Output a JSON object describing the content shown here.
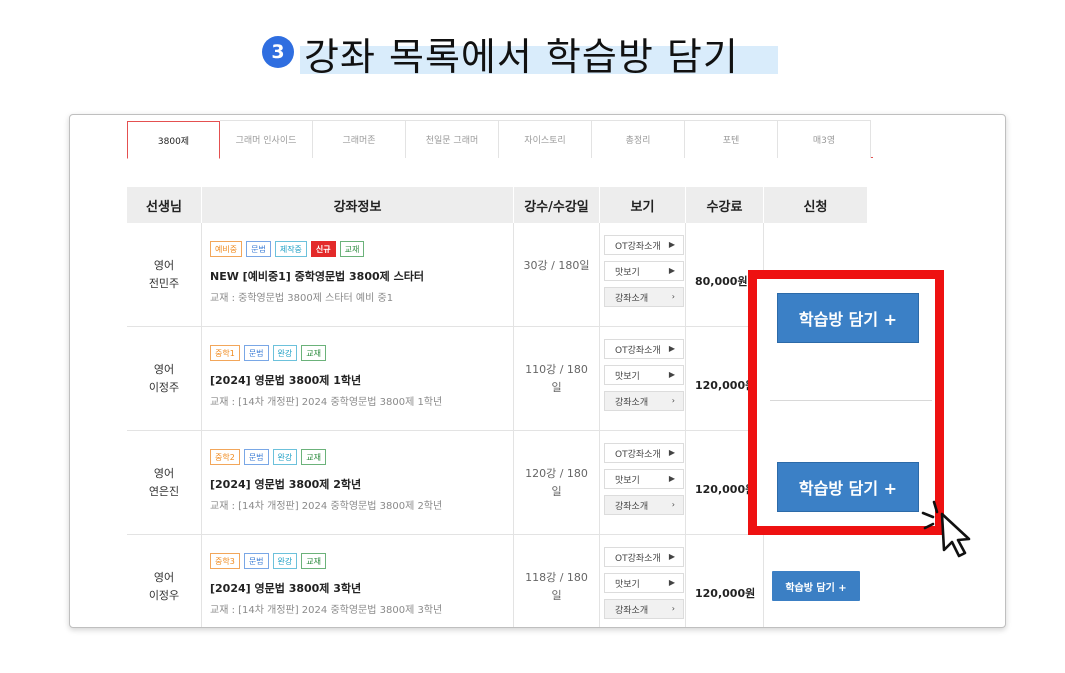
{
  "heading": {
    "step": "3",
    "title": "강좌 목록에서 학습방 담기"
  },
  "tabs": [
    {
      "label": "3800제",
      "active": true
    },
    {
      "label": "그래머 인사이드"
    },
    {
      "label": "그래머존"
    },
    {
      "label": "천일문 그래머"
    },
    {
      "label": "자이스토리"
    },
    {
      "label": "총정리"
    },
    {
      "label": "포텐"
    },
    {
      "label": "매3영"
    }
  ],
  "table": {
    "headers": {
      "teacher": "선생님",
      "info": "강좌정보",
      "count": "강수/수강일",
      "view": "보기",
      "fee": "수강료",
      "apply": "신청"
    },
    "view_buttons": {
      "ot": "OT강좌소개",
      "preview": "맛보기",
      "intro": "강좌소개"
    },
    "rows": [
      {
        "subject": "영어",
        "teacher": "전민주",
        "badges": [
          "예비중",
          "문법",
          "제작중",
          "신규",
          "교재"
        ],
        "title": "NEW [예비중1] 중학영문법 3800제 스타터",
        "book": "교재 : 중학영문법 3800제 스타터 예비 중1",
        "count_line1": "30강 / 180일",
        "count_line2": "",
        "fee": "80,000원"
      },
      {
        "subject": "영어",
        "teacher": "이정주",
        "badges": [
          "중학1",
          "문법",
          "완강",
          "교재"
        ],
        "title": "[2024] 영문법 3800제 1학년",
        "book": "교재 : [14차 개정판] 2024 중학영문법 3800제 1학년",
        "count_line1": "110강 / 180",
        "count_line2": "일",
        "fee": "120,000원"
      },
      {
        "subject": "영어",
        "teacher": "연은진",
        "badges": [
          "중학2",
          "문법",
          "완강",
          "교재"
        ],
        "title": "[2024] 영문법 3800제 2학년",
        "book": "교재 : [14차 개정판] 2024 중학영문법 3800제 2학년",
        "count_line1": "120강 / 180",
        "count_line2": "일",
        "fee": "120,000원"
      },
      {
        "subject": "영어",
        "teacher": "이정우",
        "badges": [
          "중학3",
          "문법",
          "완강",
          "교재"
        ],
        "title": "[2024] 영문법 3800제 3학년",
        "book": "교재 : [14차 개정판] 2024 중학영문법 3800제 3학년",
        "count_line1": "118강 / 180",
        "count_line2": "일",
        "fee": "120,000원"
      }
    ],
    "apply_label_big": "학습방 담기 +",
    "apply_label_small": "학습방 담기 +"
  },
  "colors": {
    "accent_blue": "#3b80c6",
    "highlight_red": "#ee1111",
    "step_blue": "#2f6ee0"
  }
}
